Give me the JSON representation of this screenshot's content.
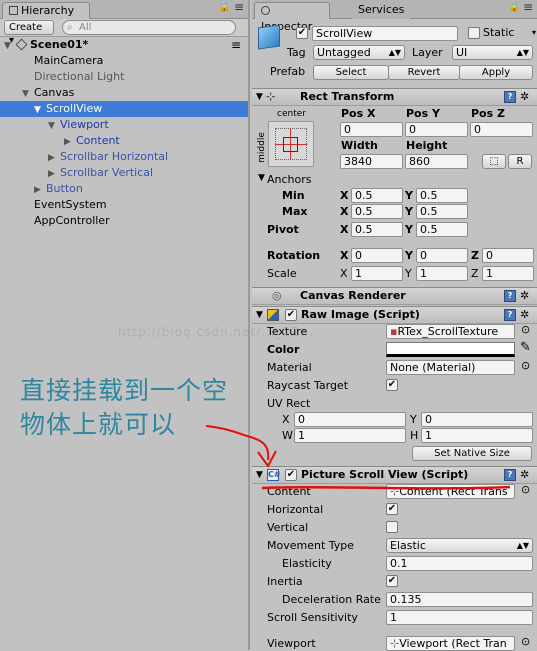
{
  "hierarchy": {
    "tab_label": "Hierarchy",
    "create_label": "Create ▾",
    "search_placeholder": "All",
    "scene_label": "Scene01*",
    "items": [
      {
        "label": "MainCamera"
      },
      {
        "label": "Directional Light"
      },
      {
        "label": "Canvas"
      },
      {
        "label": "ScrollView"
      },
      {
        "label": "Viewport"
      },
      {
        "label": "Content"
      },
      {
        "label": "Scrollbar Horizontal"
      },
      {
        "label": "Scrollbar Vertical"
      },
      {
        "label": "Button"
      },
      {
        "label": "EventSystem"
      },
      {
        "label": "AppController"
      }
    ]
  },
  "inspector": {
    "tab_inspector": "Inspector",
    "tab_services": "Services",
    "object_name": "ScrollView",
    "static_label": "Static",
    "tag_label": "Tag",
    "tag_value": "Untagged",
    "layer_label": "Layer",
    "layer_value": "UI",
    "prefab_label": "Prefab",
    "prefab_buttons": [
      "Select",
      "Revert",
      "Apply"
    ],
    "rect_transform": {
      "title": "Rect Transform",
      "anchor_top": "center",
      "anchor_side": "middle",
      "pos_labels": [
        "Pos X",
        "Pos Y",
        "Pos Z"
      ],
      "pos_values": [
        "0",
        "0",
        "0"
      ],
      "width_label": "Width",
      "height_label": "Height",
      "width": "3840",
      "height": "860",
      "r_button": "R",
      "anchors_label": "Anchors",
      "min_label": "Min",
      "max_label": "Max",
      "pivot_label": "Pivot",
      "min_x": "0.5",
      "min_y": "0.5",
      "max_x": "0.5",
      "max_y": "0.5",
      "pivot_x": "0.5",
      "pivot_y": "0.5",
      "rotation_label": "Rotation",
      "rotation": [
        "0",
        "0",
        "0"
      ],
      "scale_label": "Scale",
      "scale": [
        "1",
        "1",
        "1"
      ],
      "x": "X",
      "y": "Y",
      "z": "Z"
    },
    "canvas_renderer": {
      "title": "Canvas Renderer"
    },
    "raw_image": {
      "title": "Raw Image (Script)",
      "texture_label": "Texture",
      "texture_value": "RTex_ScrollTexture",
      "color_label": "Color",
      "material_label": "Material",
      "material_value": "None (Material)",
      "raycast_label": "Raycast Target",
      "uvrect_label": "UV Rect",
      "uv_x": "0",
      "uv_y": "0",
      "uv_w": "1",
      "uv_h": "1",
      "x": "X",
      "y": "Y",
      "w": "W",
      "h": "H",
      "native_button": "Set Native Size"
    },
    "picture_scroll": {
      "title": "Picture Scroll View (Script)",
      "content_label": "Content",
      "content_value": "Content (Rect Trans",
      "horizontal_label": "Horizontal",
      "vertical_label": "Vertical",
      "movement_label": "Movement Type",
      "movement_value": "Elastic",
      "elasticity_label": "Elasticity",
      "elasticity_value": "0.1",
      "inertia_label": "Inertia",
      "decel_label": "Deceleration Rate",
      "decel_value": "0.135",
      "sensitivity_label": "Scroll Sensitivity",
      "sensitivity_value": "1",
      "viewport_label": "Viewport",
      "viewport_value": "Viewport (Rect Tran"
    }
  },
  "annotation": {
    "line1": "直接挂载到一个空",
    "line2": "物体上就可以",
    "color": "#2e86a0",
    "arrow_color": "#e01010"
  },
  "watermark": "http://blog.csdn.net/..._12...",
  "colors": {
    "selection": "#3d7bd4",
    "panel": "#c2c2c2"
  }
}
